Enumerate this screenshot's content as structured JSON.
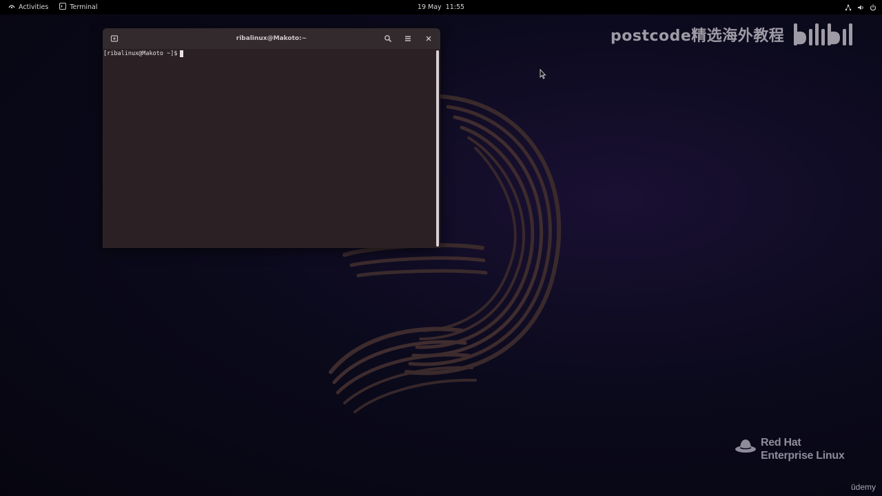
{
  "topbar": {
    "activities_label": "Activities",
    "app_label": "Terminal",
    "date": "19 May",
    "time": "11:55",
    "tray_icons": [
      "network-icon",
      "volume-icon",
      "power-icon"
    ]
  },
  "terminal": {
    "title": "ribalinux@Makoto:~",
    "prompt": "[ribalinux@Makoto ~]$",
    "buttons": [
      "new-tab-icon",
      "search-icon",
      "menu-icon",
      "close-icon"
    ]
  },
  "watermark": {
    "text": "postcode精选海外教程",
    "logo_text": "bilibili"
  },
  "branding": {
    "redhat_line1": "Red Hat",
    "redhat_line2": "Enterprise Linux",
    "udemy": "ūdemy"
  },
  "colors": {
    "terminal_bg": "#2b2124",
    "terminal_header": "#332a2d",
    "desktop_bg": "#0b0a1c",
    "topbar_bg": "#000000"
  }
}
